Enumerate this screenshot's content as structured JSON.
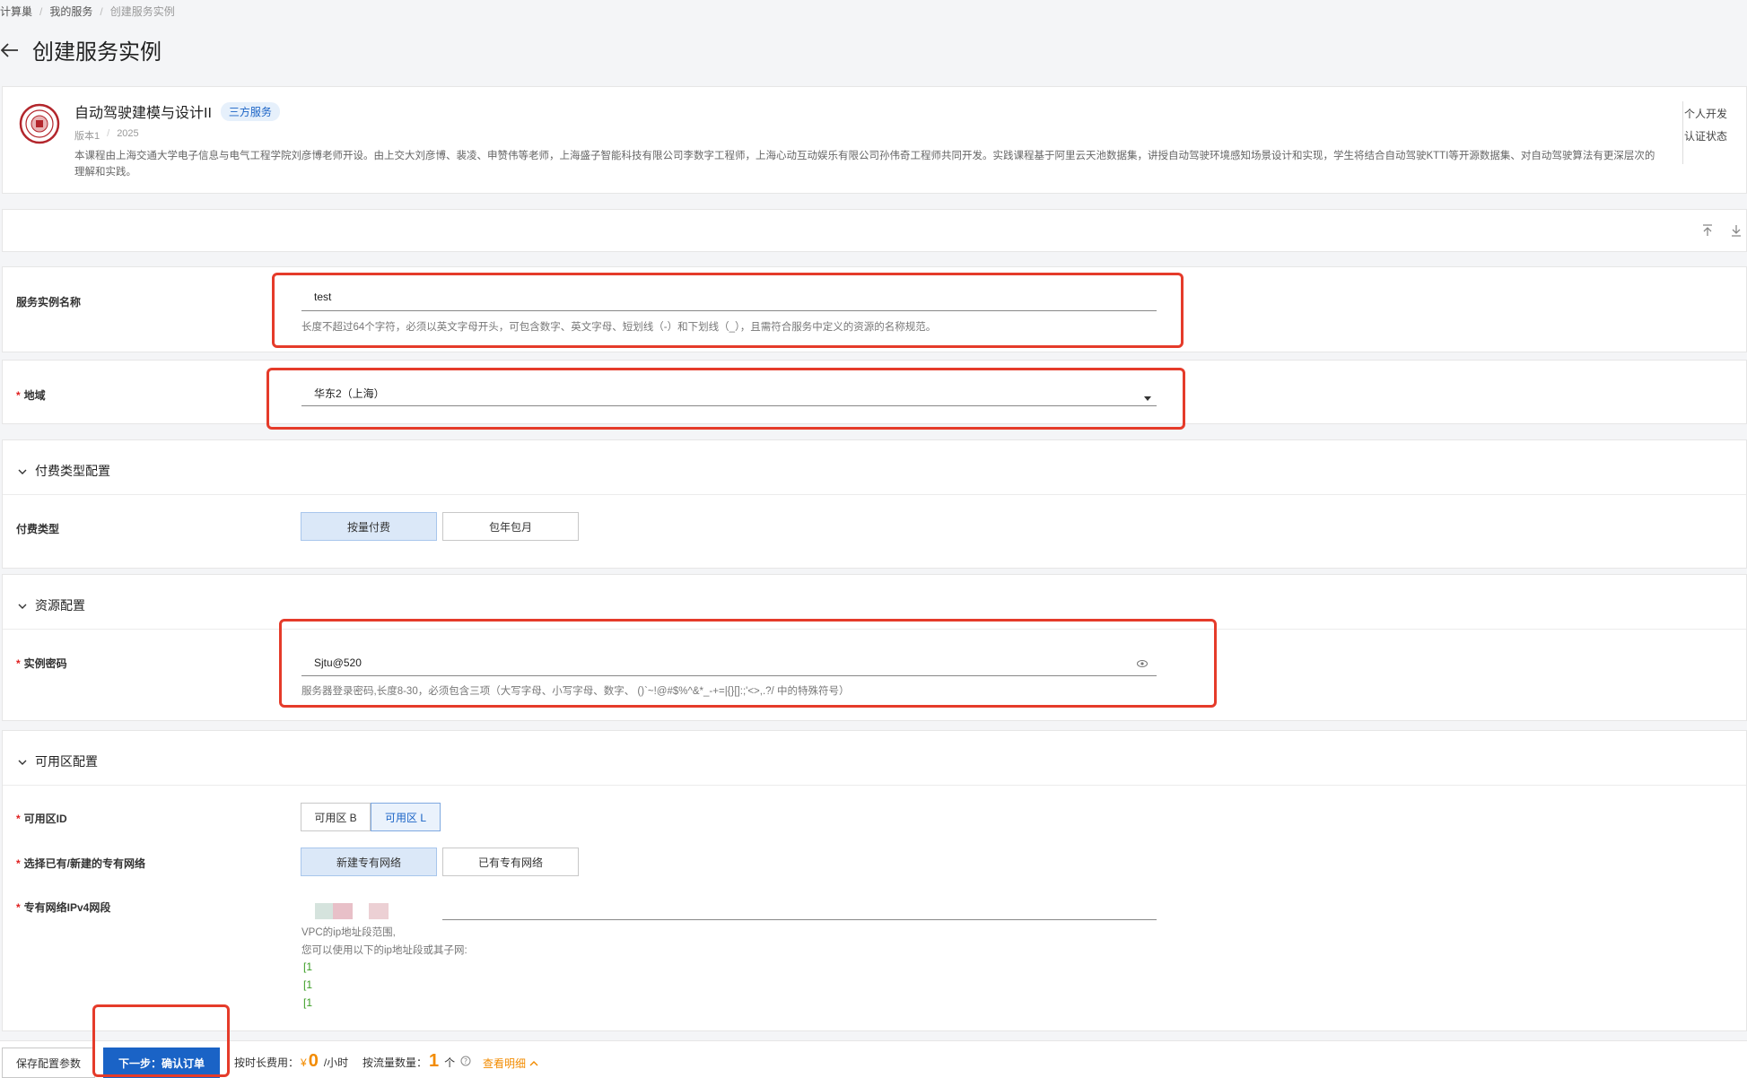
{
  "breadcrumb": {
    "items": [
      "计算巢",
      "我的服务",
      "创建服务实例"
    ]
  },
  "page": {
    "title": "创建服务实例"
  },
  "service": {
    "name": "自动驾驶建模与设计II",
    "tag": "三方服务",
    "version": "版本1",
    "year": "2025",
    "description": "本课程由上海交通大学电子信息与电气工程学院刘彦博老师开设。由上交大刘彦博、裴凌、申赞伟等老师，上海盛子智能科技有限公司李数字工程师，上海心动互动娱乐有限公司孙伟奇工程师共同开发。实践课程基于阿里云天池数据集，讲授自动驾驶环境感知场景设计和实现，学生将结合自动驾驶KTTI等开源数据集、对自动驾驶算法有更深层次的理解和实践。",
    "right_line1": "个人开发",
    "right_line2": "认证状态"
  },
  "fields": {
    "instance_name": {
      "label": "服务实例名称",
      "value": "test",
      "help": "长度不超过64个字符，必须以英文字母开头，可包含数字、英文字母、短划线（-）和下划线（_），且需符合服务中定义的资源的名称规范。"
    },
    "region": {
      "label": "地域",
      "value": "华东2（上海）"
    }
  },
  "billing": {
    "section_title": "付费类型配置",
    "label": "付费类型",
    "options": [
      "按量付费",
      "包年包月"
    ]
  },
  "resource": {
    "section_title": "资源配置",
    "password_label": "实例密码",
    "password_value": "Sjtu@520",
    "password_help": "服务器登录密码,长度8-30，必须包含三项（大写字母、小写字母、数字、 ()`~!@#$%^&*_-+=|{}[]:;'<>,.?/ 中的特殊符号）"
  },
  "zone": {
    "section_title": "可用区配置",
    "zone_label": "可用区ID",
    "zone_options": [
      "可用区 B",
      "可用区 L"
    ],
    "vpc_label": "选择已有/新建的专有网络",
    "vpc_options": [
      "新建专有网络",
      "已有专有网络"
    ],
    "cidr_label": "专有网络IPv4网段",
    "cidr_help1": "VPC的ip地址段范围,",
    "cidr_help2": "您可以使用以下的ip地址段或其子网:",
    "cidr_items": [
      "[1",
      "[1",
      "[1"
    ]
  },
  "footer": {
    "save_label": "保存配置参数",
    "next_label": "下一步：确认订单",
    "hourly_label": "按时长费用：",
    "currency": "¥",
    "hourly_price": "0",
    "hourly_unit": "/小时",
    "traffic_label": "按流量数量：",
    "traffic_count": "1",
    "traffic_unit": "个",
    "detail_link": "查看明细"
  },
  "colors": {
    "accent": "#1a63c6",
    "highlight_box": "#e53b2a",
    "price": "#f28b00",
    "green": "#3a9d23"
  }
}
